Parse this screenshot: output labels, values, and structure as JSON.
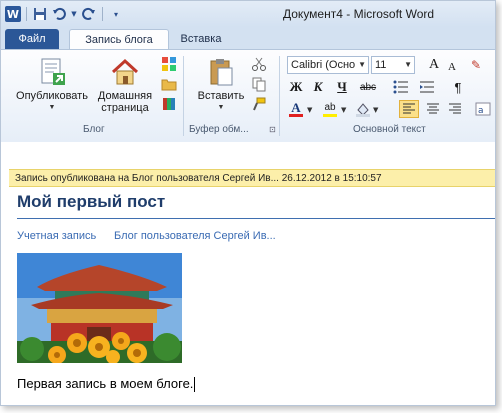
{
  "window": {
    "title": "Документ4  -  Microsoft Word",
    "qat": {
      "app_icon": "W",
      "save": "save-icon",
      "undo": "undo-icon",
      "redo": "redo-icon"
    }
  },
  "tabs": {
    "file": "Файл",
    "blog_post": "Запись блога",
    "insert": "Вставка"
  },
  "ribbon": {
    "blog_group": {
      "label": "Блог",
      "publish": "Опубликовать",
      "home_page_line1": "Домашняя",
      "home_page_line2": "страница"
    },
    "clipboard_group": {
      "label": "Буфер обм...",
      "paste": "Вставить"
    },
    "text_group": {
      "label": "Основной текст",
      "font_name": "Calibri (Осно",
      "font_size": "11",
      "bold": "Ж",
      "italic": "К",
      "underline": "Ч",
      "strike": "abc",
      "grow": "A",
      "shrink": "A",
      "font_color": "A",
      "highlight": "ab",
      "pilcrow": "¶"
    }
  },
  "document": {
    "notice": "Запись опубликована на Блог пользователя Сергей Ив... 26.12.2012 в 15:10:57",
    "post_title": "Мой первый пост",
    "account_link": "Учетная запись",
    "blog_link": "Блог пользователя Сергей Ив...",
    "body": "Первая запись в моем блоге."
  },
  "colors": {
    "file_tab": "#2b5797",
    "notice_bg": "#fcefaa",
    "title": "#1f3d6b",
    "link": "#3a6bb3"
  }
}
